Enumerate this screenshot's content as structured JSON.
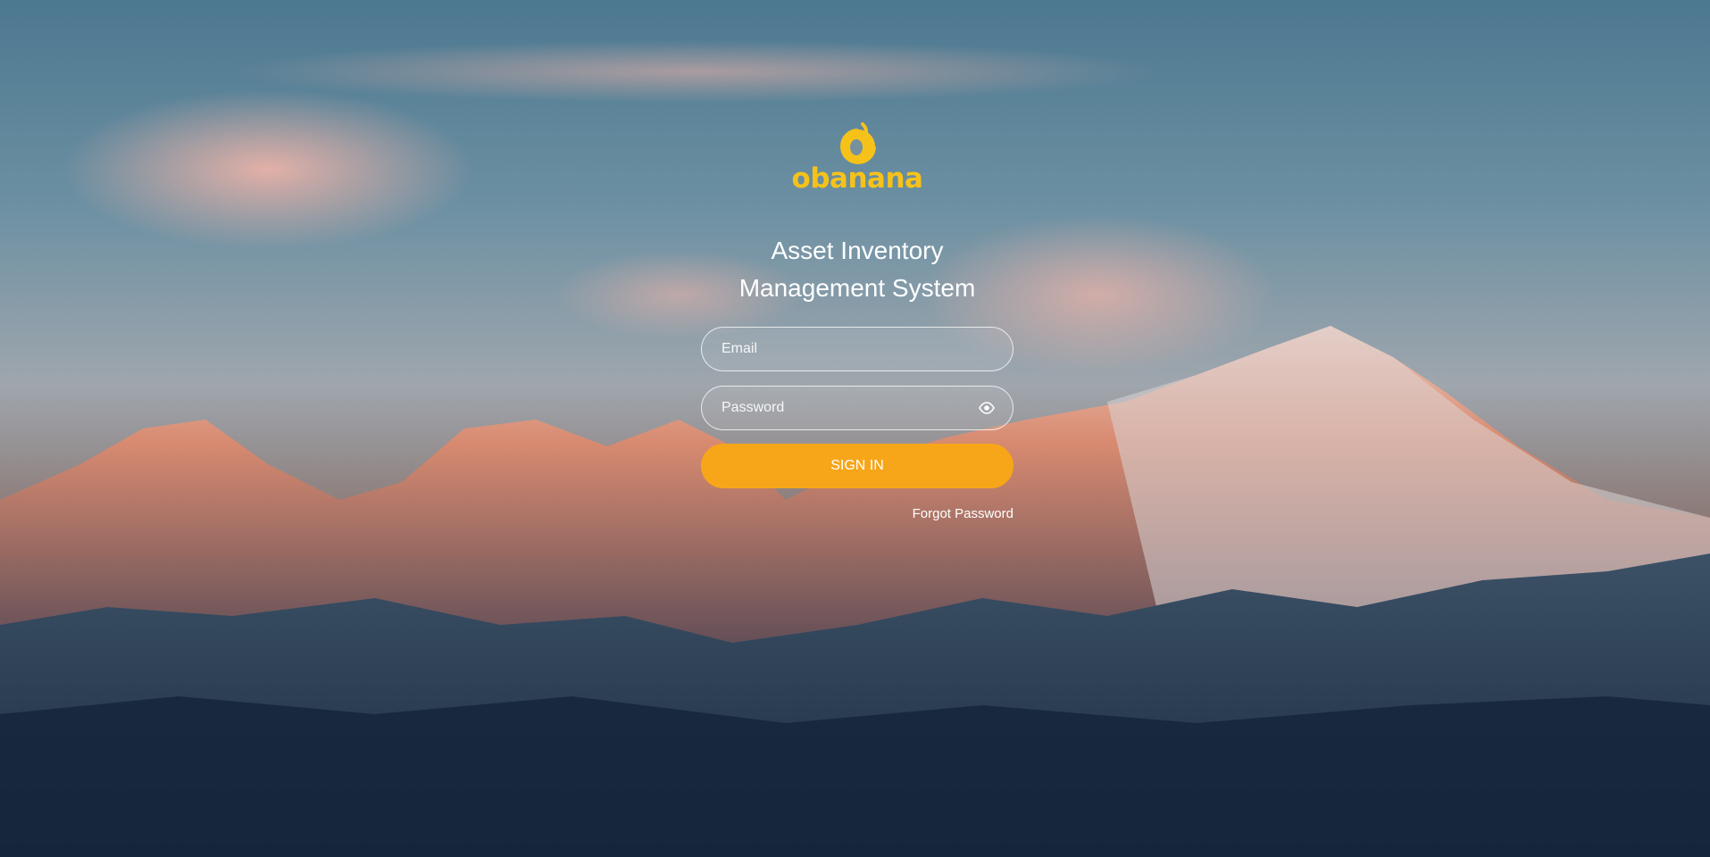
{
  "brand": {
    "logo_text": "obanana",
    "color": "#f6c21a"
  },
  "title": {
    "line1": "Asset Inventory",
    "line2": "Management System"
  },
  "form": {
    "email_placeholder": "Email",
    "password_placeholder": "Password",
    "password_toggle_icon": "eye-icon",
    "signin_label": "SIGN IN",
    "signin_color": "#f7a619",
    "forgot_label": "Forgot Password"
  }
}
